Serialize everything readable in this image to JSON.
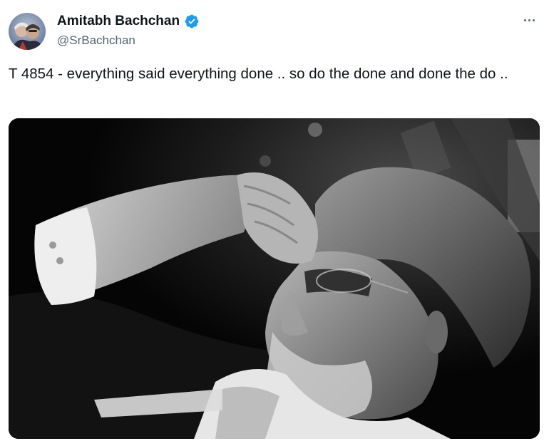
{
  "tweet": {
    "author": {
      "display_name": "Amitabh Bachchan",
      "handle": "@SrBachchan",
      "verified": true,
      "verified_color": "#1d9bf0"
    },
    "text": "T 4854 - everything said everything done .. so do the done and done the do ..",
    "more_icon": "more-horizontal-icon",
    "media": {
      "type": "photo",
      "style": "black-and-white"
    }
  },
  "colors": {
    "text_primary": "#0f1419",
    "text_secondary": "#536471",
    "verified": "#1d9bf0",
    "background": "#ffffff"
  }
}
